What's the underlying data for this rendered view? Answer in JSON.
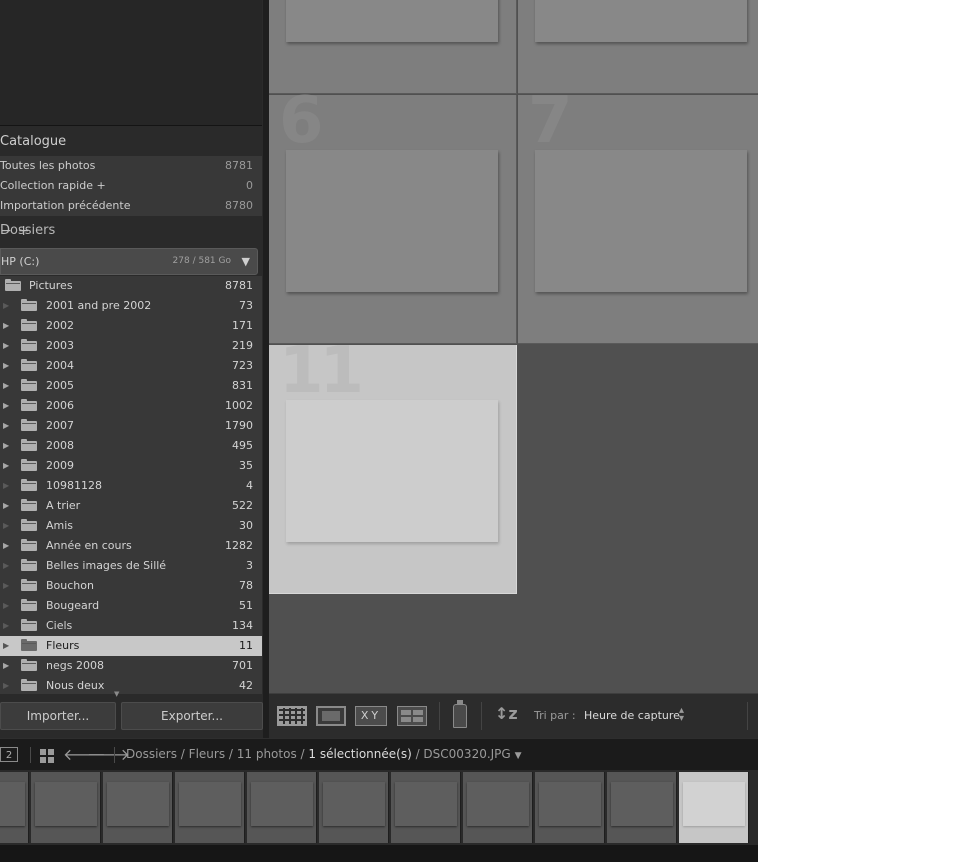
{
  "catalogue": {
    "title": "Catalogue",
    "items": [
      {
        "label": "Toutes les photos",
        "count": "8781"
      },
      {
        "label": "Collection rapide +",
        "count": "0"
      },
      {
        "label": "Importation précédente",
        "count": "8780"
      }
    ]
  },
  "dossiers": {
    "title": "Dossiers",
    "volume": {
      "name": "HP (C:)",
      "size": "278 / 581 Go"
    },
    "root": {
      "name": "Pictures",
      "count": "8781"
    },
    "folders": [
      {
        "name": "2001 and pre 2002",
        "count": "73",
        "expandable": false,
        "selected": false
      },
      {
        "name": "2002",
        "count": "171",
        "expandable": true,
        "selected": false
      },
      {
        "name": "2003",
        "count": "219",
        "expandable": true,
        "selected": false
      },
      {
        "name": "2004",
        "count": "723",
        "expandable": true,
        "selected": false
      },
      {
        "name": "2005",
        "count": "831",
        "expandable": true,
        "selected": false
      },
      {
        "name": "2006",
        "count": "1002",
        "expandable": true,
        "selected": false
      },
      {
        "name": "2007",
        "count": "1790",
        "expandable": true,
        "selected": false
      },
      {
        "name": "2008",
        "count": "495",
        "expandable": true,
        "selected": false
      },
      {
        "name": "2009",
        "count": "35",
        "expandable": true,
        "selected": false
      },
      {
        "name": "10981128",
        "count": "4",
        "expandable": false,
        "selected": false
      },
      {
        "name": "A trier",
        "count": "522",
        "expandable": true,
        "selected": false
      },
      {
        "name": "Amis",
        "count": "30",
        "expandable": false,
        "selected": false
      },
      {
        "name": "Année en cours",
        "count": "1282",
        "expandable": true,
        "selected": false
      },
      {
        "name": "Belles images de Sillé",
        "count": "3",
        "expandable": false,
        "selected": false
      },
      {
        "name": "Bouchon",
        "count": "78",
        "expandable": false,
        "selected": false
      },
      {
        "name": "Bougeard",
        "count": "51",
        "expandable": false,
        "selected": false
      },
      {
        "name": "Ciels",
        "count": "134",
        "expandable": false,
        "selected": false
      },
      {
        "name": "Fleurs",
        "count": "11",
        "expandable": false,
        "selected": true
      },
      {
        "name": "negs 2008",
        "count": "701",
        "expandable": true,
        "selected": false
      },
      {
        "name": "Nous deux",
        "count": "42",
        "expandable": false,
        "selected": false
      }
    ]
  },
  "buttons": {
    "import": "Importer...",
    "export": "Exporter..."
  },
  "grid": {
    "cells": [
      {
        "num": "",
        "selected": false
      },
      {
        "num": "",
        "selected": false
      },
      {
        "num": "6",
        "selected": false
      },
      {
        "num": "7",
        "selected": false
      },
      {
        "num": "11",
        "selected": true
      }
    ]
  },
  "toolbar": {
    "compare_label": "XY",
    "sort_label": "Tri par :",
    "sort_value": "Heure de capture"
  },
  "filmstrip_bar": {
    "monitor": "2",
    "crumb_path": "Dossiers / Fleurs / 11 photos / ",
    "crumb_selected": "1 sélectionnée(s)",
    "crumb_file": " / DSC00320.JPG"
  },
  "filmstrip": {
    "count": 11,
    "selected_index": 10
  },
  "colors": {
    "panel_bg": "#383838",
    "selected_row": "#c8c8c8",
    "grid_bg": "#505050",
    "cell_bg": "#7e7e7e",
    "selected_cell": "#c6c6c6"
  }
}
